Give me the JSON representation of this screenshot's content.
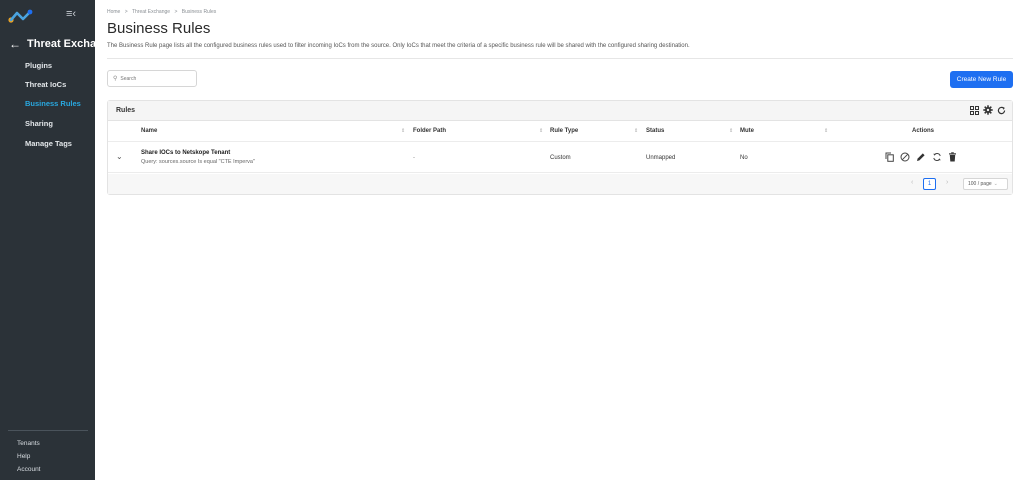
{
  "sidebar": {
    "back_label": "Threat Exchange",
    "items": [
      {
        "label": "Plugins",
        "active": false
      },
      {
        "label": "Threat IoCs",
        "active": false
      },
      {
        "label": "Business Rules",
        "active": true
      },
      {
        "label": "Sharing",
        "active": false
      },
      {
        "label": "Manage Tags",
        "active": false
      }
    ],
    "bottom": [
      "Tenants",
      "Help",
      "Account"
    ],
    "icons": {
      "logo": "netskope-logo",
      "collapse": "menu-collapse-icon",
      "back": "arrow-left-icon"
    }
  },
  "breadcrumb": [
    "Home",
    ">",
    "Threat Exchange",
    ">",
    "Business Rules"
  ],
  "page": {
    "title": "Business Rules",
    "description": "The Business Rule page lists all the configured business rules used to filter incoming IoCs from the source. Only IoCs that meet the criteria of a specific business rule will be shared with the configured sharing destination."
  },
  "search": {
    "placeholder": "Search"
  },
  "create_button": "Create New Rule",
  "card": {
    "title": "Rules"
  },
  "table": {
    "columns": [
      "Name",
      "Folder Path",
      "Rule Type",
      "Status",
      "Mute",
      "Actions"
    ],
    "rows": [
      {
        "name": "Share IOCs to Netskope Tenant",
        "query": "Query: sources.source Is equal \"CTE Imperva\"",
        "folder_path": "-",
        "rule_type": "Custom",
        "status": "Unmapped",
        "mute": "No"
      }
    ]
  },
  "pagination": {
    "current": "1",
    "page_size": "100 / page"
  },
  "colors": {
    "accent": "#1e6ff1",
    "sidebar_bg": "#2b3238",
    "active_item": "#29a8e0"
  }
}
